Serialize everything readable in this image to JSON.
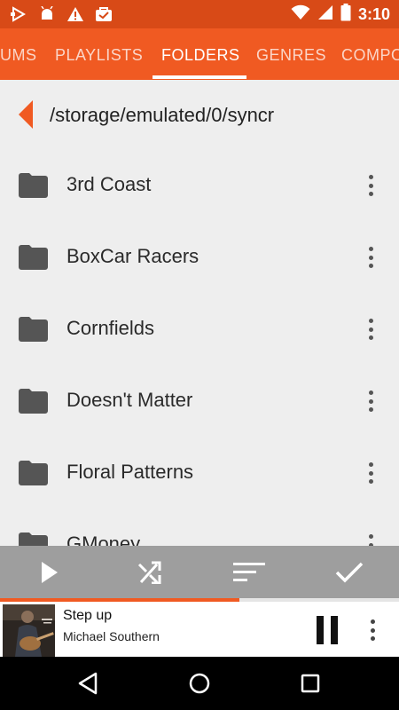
{
  "status_bar": {
    "time": "3:10",
    "left_icons": [
      "play-store-notification-icon",
      "android-debug-icon",
      "warning-icon",
      "mail-bag-icon"
    ],
    "right_icons": [
      "wifi-icon",
      "signal-icon",
      "battery-icon"
    ],
    "color": "#d84a17"
  },
  "tabs": {
    "items": [
      {
        "label": "UMS"
      },
      {
        "label": "PLAYLISTS"
      },
      {
        "label": "FOLDERS"
      },
      {
        "label": "GENRES"
      },
      {
        "label": "COMPO"
      }
    ],
    "active": "FOLDERS",
    "color": "#f05a22"
  },
  "browser": {
    "path": "/storage/emulated/0/syncr",
    "folders": [
      {
        "name": "3rd Coast"
      },
      {
        "name": "BoxCar Racers"
      },
      {
        "name": "Cornfields"
      },
      {
        "name": "Doesn't Matter"
      },
      {
        "name": "Floral Patterns"
      },
      {
        "name": "GMoney"
      }
    ]
  },
  "actions": {
    "items": [
      "play-icon",
      "shuffle-icon",
      "sort-icon",
      "select-icon"
    ]
  },
  "now_playing": {
    "title": "Step up",
    "artist": "Michael Southern",
    "progress": 0.6,
    "accent": "#f05a22"
  },
  "nav": {
    "items": [
      "back-icon",
      "home-icon",
      "recents-icon"
    ]
  }
}
